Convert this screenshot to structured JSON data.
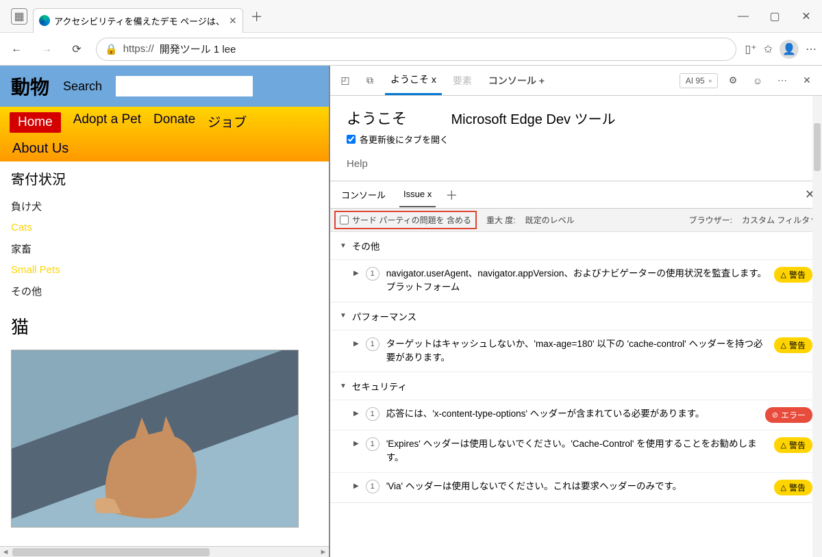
{
  "browser": {
    "tab_title": "アクセシビリティを備えたデモ ページは、",
    "url_prefix": "https://",
    "url_rest": "開発ツール 1 lee"
  },
  "page": {
    "title": "動物",
    "search_label": "Search",
    "nav": [
      "Home",
      "Adopt a Pet",
      "Donate",
      "ジョブ"
    ],
    "nav2": "About Us",
    "section": "寄付状況",
    "pets": [
      {
        "label": "負け犬",
        "hl": false
      },
      {
        "label": "Cats",
        "hl": true
      },
      {
        "label": "家畜",
        "hl": false
      },
      {
        "label": "Small Pets",
        "hl": true
      },
      {
        "label": "その他",
        "hl": false
      }
    ],
    "cats_heading": "猫"
  },
  "devtools": {
    "tabs": {
      "welcome": "ようこそ x",
      "elements": "要素",
      "console": "コンソール +"
    },
    "ai_badge": "AI 95",
    "welcome_h": "ようこそ",
    "welcome_sub": "Microsoft Edge Dev ツール",
    "open_tab_label": "各更新後にタブを開く",
    "help": "Help"
  },
  "drawer": {
    "tabs": {
      "console": "コンソール",
      "issue": "Issue x"
    },
    "third_party": "サード パーティの問題を 含める",
    "severity_l": "重大 度:",
    "severity_v": "既定のレベル",
    "browser_l": "ブラウザー:",
    "browser_v": "カスタム フィルタ▼",
    "groups": [
      {
        "name": "その他",
        "issues": [
          {
            "count": "1",
            "text": "navigator.userAgent、navigator.appVersion、およびナビゲーターの使用状況を監査します。プラットフォーム",
            "badge": "warn",
            "badge_label": "警告"
          }
        ]
      },
      {
        "name": "パフォーマンス",
        "issues": [
          {
            "count": "1",
            "text": "ターゲットはキャッシュしないか、'max-age=180' 以下の 'cache-control' ヘッダーを持つ必要があります。",
            "badge": "warn",
            "badge_label": "警告"
          }
        ]
      },
      {
        "name": "セキュリティ",
        "issues": [
          {
            "count": "1",
            "text": "応答には、'x-content-type-options' ヘッダーが含まれている必要があります。",
            "badge": "err",
            "badge_label": "エラー"
          },
          {
            "count": "1",
            "text": "'Expires' ヘッダーは使用しないでください。'Cache-Control' を使用することをお勧めします。",
            "badge": "warn",
            "badge_label": "警告"
          },
          {
            "count": "1",
            "text": "'Via' ヘッダーは使用しないでください。これは要求ヘッダーのみです。",
            "badge": "warn",
            "badge_label": "警告"
          }
        ]
      }
    ]
  }
}
